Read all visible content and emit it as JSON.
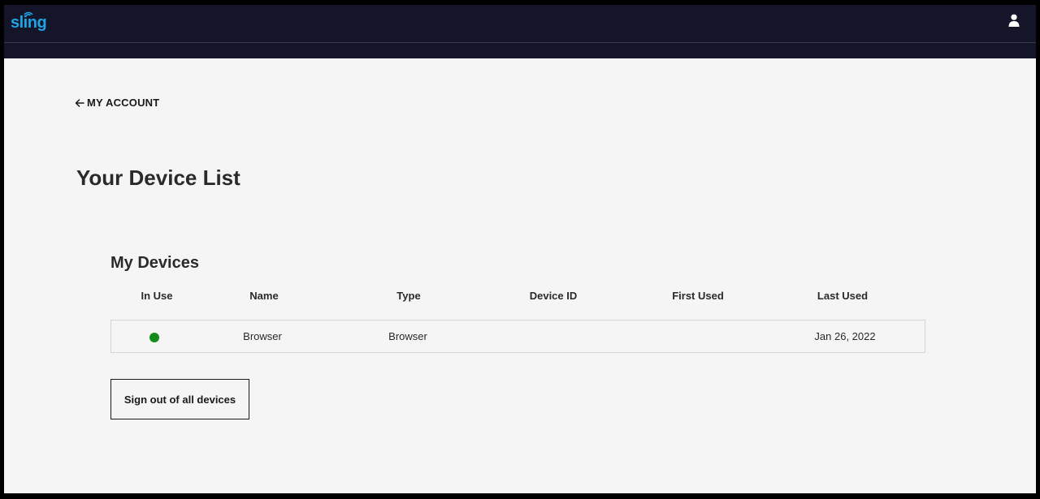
{
  "header": {
    "logo_text": "sling",
    "logo_icon": "sling-waves-icon",
    "user_icon": "user-icon",
    "colors": {
      "background": "#15152a",
      "logo": "#1fa3e4",
      "icon": "#ffffff"
    }
  },
  "nav": {
    "back_label": "MY ACCOUNT",
    "back_icon": "arrow-left-icon"
  },
  "page": {
    "title": "Your Device List"
  },
  "devices": {
    "section_title": "My Devices",
    "columns": [
      "In Use",
      "Name",
      "Type",
      "Device ID",
      "First Used",
      "Last Used"
    ],
    "rows": [
      {
        "in_use": true,
        "in_use_color": "#138a1a",
        "name": "Browser",
        "type": "Browser",
        "device_id": "",
        "first_used": "",
        "last_used": "Jan 26, 2022"
      }
    ]
  },
  "actions": {
    "signout_label": "Sign out of all devices"
  }
}
